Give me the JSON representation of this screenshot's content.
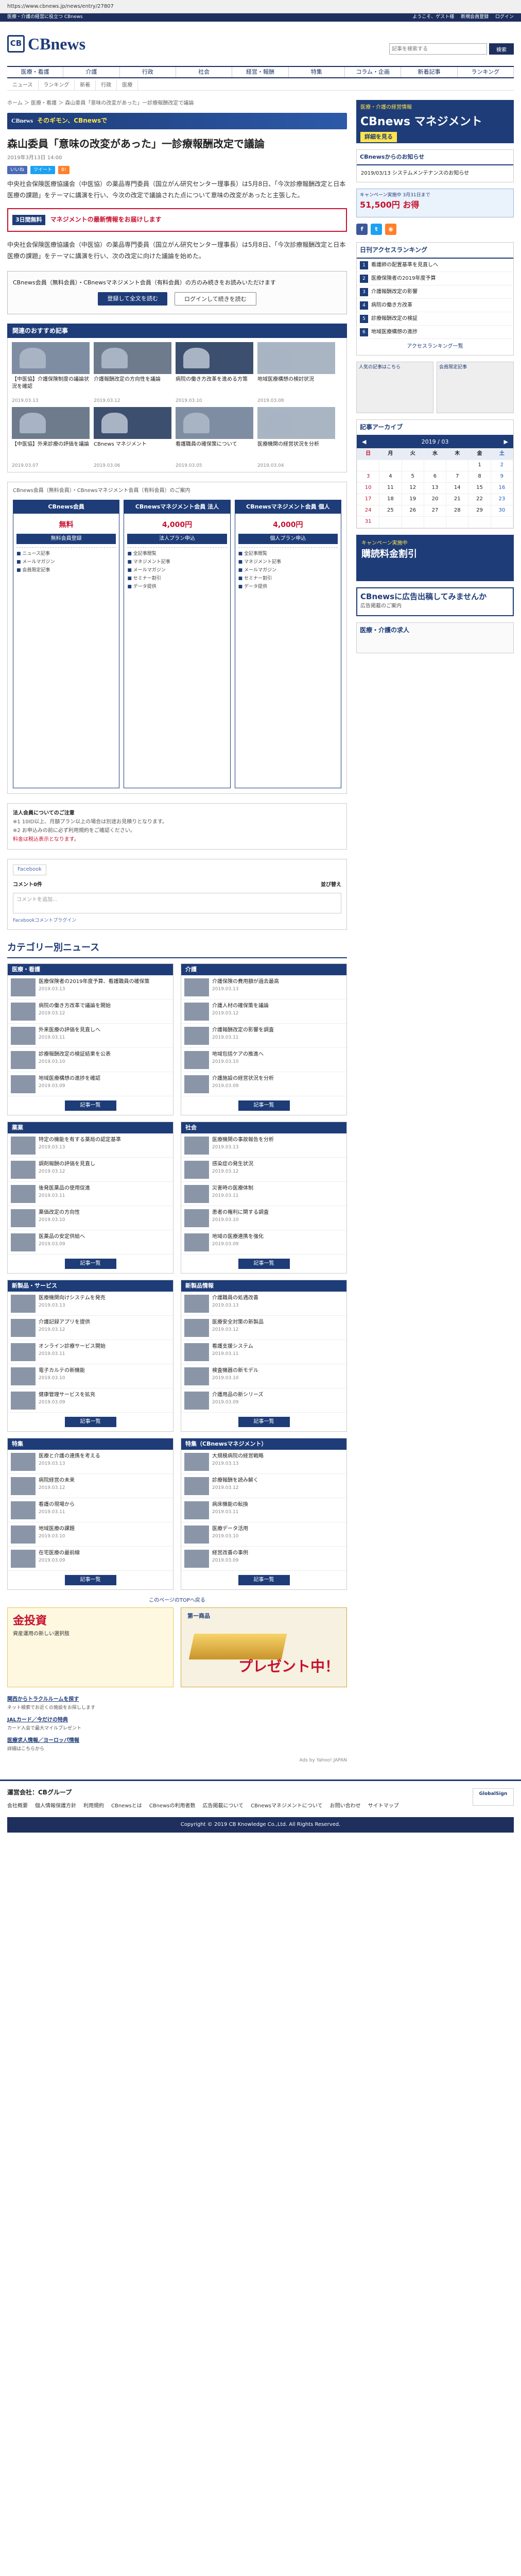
{
  "browser": {
    "url": "https://www.cbnews.jp/news/entry/27807"
  },
  "top": {
    "left": "医療・介護の経営に役立つ CBnews",
    "links": [
      "ようこそ、ゲスト様",
      "新規会員登録",
      "ログイン"
    ]
  },
  "brand": {
    "mark": "CB",
    "name": "CBnews"
  },
  "search": {
    "placeholder": "記事を検索する",
    "button": "検索"
  },
  "nav": [
    "医療・看護",
    "介護",
    "行政",
    "社会",
    "経営・報酬",
    "特集",
    "コラム・企画",
    "新着記事",
    "ランキング"
  ],
  "subnav": [
    "ニュース",
    "ランキング",
    "新着",
    "行政",
    "医療"
  ],
  "breadcrumb": "ホーム ＞ 医療・看護 ＞ 森山委員「意味の改変があった」一診療報酬改定で議論",
  "banner": {
    "logo": "CBnews",
    "text": "そのギモン、CBnewsで"
  },
  "article": {
    "title": "森山委員「意味の改変があった」一診療報酬改定で議論",
    "date": "2019年3月13日 14:00",
    "share": [
      "いいね",
      "ツイート",
      "B!"
    ],
    "p1": "中央社会保険医療協議会（中医協）の薬品専門委員（国立がん研究センター理事長）は5月8日、「今次診療報酬改定と日本医療の課題」をテーマに講演を行い、今次の改定で議論された点について意味の改変があったと主張した。",
    "p2": "中央社会保険医療協議会（中医協）の薬品専門委員（国立がん研究センター理事長）は5月8日、「今次診療報酬改定と日本医療の課題」をテーマに講演を行い、次の改定に向けた議論を始めた。",
    "lock_text": "CBnews会員（無料会員）・CBnewsマネジメント会員（有料会員）の方のみ続きをお読みいただけます",
    "lock_login": "登録して全文を読む",
    "lock_member": "ログインして続きを読む"
  },
  "promo": {
    "label": "3日間無料",
    "text": "マネジメントの最新情報をお届けします"
  },
  "related": {
    "title": "関連のおすすめ記事",
    "items": [
      {
        "title": "【中医協】介護保険制度の議論状況を確認",
        "date": "2019.03.13"
      },
      {
        "title": "介護報酬改定の方向性を議論",
        "date": "2019.03.12"
      },
      {
        "title": "病院の働き方改革を進める方策",
        "date": "2019.03.10"
      },
      {
        "title": "地域医療構想の検討状況",
        "date": "2019.03.08"
      },
      {
        "title": "【中医協】外来診療の評価を議論",
        "date": "2019.03.07"
      },
      {
        "title": "CBnews マネジメント",
        "date": "2019.03.06"
      },
      {
        "title": "看護職員の確保策について",
        "date": "2019.03.05"
      },
      {
        "title": "医療機関の経営状況を分析",
        "date": "2019.03.04"
      }
    ]
  },
  "plans": {
    "intro": "CBnews会員（無料会員）・CBnewsマネジメント会員（有料会員）のご案内",
    "cols": [
      {
        "name": "CBnews会員",
        "price": "無料",
        "btn": "無料会員登録",
        "feats": [
          "ニュース記事",
          "メールマガジン",
          "会員限定記事"
        ]
      },
      {
        "name": "CBnewsマネジメント会員 法人",
        "price": "4,000円",
        "btn": "法人プラン申込",
        "feats": [
          "全記事閲覧",
          "マネジメント記事",
          "メールマガジン",
          "セミナー割引",
          "データ提供"
        ]
      },
      {
        "name": "CBnewsマネジメント会員 個人",
        "price": "4,000円",
        "btn": "個人プラン申込",
        "feats": [
          "全記事閲覧",
          "マネジメント記事",
          "メールマガジン",
          "セミナー割引",
          "データ提供"
        ]
      }
    ]
  },
  "notes": {
    "title": "法人会員についてのご注意",
    "l1": "※1 10ID以上、月額プラン以上の場合は別途お見積りとなります。",
    "l2": "※2 お申込みの前に必ず利用規約をご確認ください。",
    "red": "料金は税込表示となります。"
  },
  "fb": {
    "tab": "Facebook",
    "count": "コメント0件",
    "sort": "並び替え",
    "placeholder": "コメントを追加...",
    "plugin": "Facebookコメントプラグイン"
  },
  "category": {
    "title": "カテゴリー別ニュース",
    "more": "記事一覧",
    "boxes": [
      {
        "name": "医療・看護",
        "items": [
          {
            "t": "医療保険者の2019年度予算、看護職員の確保策",
            "d": "2019.03.13"
          },
          {
            "t": "病院の働き方改革で議論を開始",
            "d": "2019.03.12"
          },
          {
            "t": "外来医療の評価を見直しへ",
            "d": "2019.03.11"
          },
          {
            "t": "診療報酬改定の検証結果を公表",
            "d": "2019.03.10"
          },
          {
            "t": "地域医療構想の進捗を確認",
            "d": "2019.03.09"
          }
        ]
      },
      {
        "name": "介護",
        "items": [
          {
            "t": "介護保険の費用額が過去最高",
            "d": "2019.03.13"
          },
          {
            "t": "介護人材の確保策を議論",
            "d": "2019.03.12"
          },
          {
            "t": "介護報酬改定の影響を調査",
            "d": "2019.03.11"
          },
          {
            "t": "地域包括ケアの推進へ",
            "d": "2019.03.10"
          },
          {
            "t": "介護施設の経営状況を分析",
            "d": "2019.03.09"
          }
        ]
      },
      {
        "name": "薬業",
        "items": [
          {
            "t": "特定の機能を有する薬局の認定基準",
            "d": "2019.03.13"
          },
          {
            "t": "調剤報酬の評価を見直し",
            "d": "2019.03.12"
          },
          {
            "t": "後発医薬品の使用促進",
            "d": "2019.03.11"
          },
          {
            "t": "薬価改定の方向性",
            "d": "2019.03.10"
          },
          {
            "t": "医薬品の安定供給へ",
            "d": "2019.03.09"
          }
        ]
      },
      {
        "name": "社会",
        "items": [
          {
            "t": "医療機関の事故報告を分析",
            "d": "2019.03.13"
          },
          {
            "t": "感染症の発生状況",
            "d": "2019.03.12"
          },
          {
            "t": "災害時の医療体制",
            "d": "2019.03.11"
          },
          {
            "t": "患者の権利に関する調査",
            "d": "2019.03.10"
          },
          {
            "t": "地域の医療連携を強化",
            "d": "2019.03.09"
          }
        ]
      },
      {
        "name": "新製品・サービス",
        "items": [
          {
            "t": "医療機関向けシステムを発売",
            "d": "2019.03.13"
          },
          {
            "t": "介護記録アプリを提供",
            "d": "2019.03.12"
          },
          {
            "t": "オンライン診療サービス開始",
            "d": "2019.03.11"
          },
          {
            "t": "電子カルテの新機能",
            "d": "2019.03.10"
          },
          {
            "t": "健康管理サービスを拡充",
            "d": "2019.03.09"
          }
        ]
      },
      {
        "name": "新製品情報",
        "items": [
          {
            "t": "介護職員の処遇改善",
            "d": "2019.03.13"
          },
          {
            "t": "医療安全対策の新製品",
            "d": "2019.03.12"
          },
          {
            "t": "看護支援システム",
            "d": "2019.03.11"
          },
          {
            "t": "検査機器の新モデル",
            "d": "2019.03.10"
          },
          {
            "t": "介護用品の新シリーズ",
            "d": "2019.03.09"
          }
        ]
      },
      {
        "name": "特集",
        "items": [
          {
            "t": "医療と介護の連携を考える",
            "d": "2019.03.13"
          },
          {
            "t": "病院経営の未来",
            "d": "2019.03.12"
          },
          {
            "t": "看護の現場から",
            "d": "2019.03.11"
          },
          {
            "t": "地域医療の課題",
            "d": "2019.03.10"
          },
          {
            "t": "在宅医療の最前線",
            "d": "2019.03.09"
          }
        ]
      },
      {
        "name": "特集（CBnewsマネジメント）",
        "items": [
          {
            "t": "大規模病院の経営戦略",
            "d": "2019.03.13"
          },
          {
            "t": "診療報酬を読み解く",
            "d": "2019.03.12"
          },
          {
            "t": "病床機能の転換",
            "d": "2019.03.11"
          },
          {
            "t": "医療データ活用",
            "d": "2019.03.10"
          },
          {
            "t": "経営改善の事例",
            "d": "2019.03.09"
          }
        ]
      }
    ]
  },
  "nextlink": "このページのTOPへ戻る",
  "ads": {
    "a1": "金投資",
    "a1s": "資産運用の新しい選択肢",
    "a2": "第一商品",
    "a2b": "プレゼント中！",
    "text": [
      {
        "t": "関西からトラクルルームを探す",
        "s": "ネット検索でお近くの施設をお探しします"
      },
      {
        "t": "JALカード／今だけの特典",
        "s": "カード入会で最大マイルプレゼント"
      },
      {
        "t": "医療求人情報／ヨーロッパ情報",
        "s": "詳細はこちらから"
      }
    ],
    "by": "Ads by Yahoo! JAPAN"
  },
  "side": {
    "banner_top": "医療・介護の経営情報",
    "banner_name": "CBnews マネジメント",
    "banner_btn": "詳細を見る",
    "info_title": "CBnewsからのお知らせ",
    "info_text": "2019/03/13 システムメンテナンスのお知らせ",
    "camp_1": "キャンペーン実施中 3月31日まで",
    "camp_2": "51,500円 お得",
    "rank_title": "日刊アクセスランキング",
    "rank": [
      "看護師の配置基準を見直しへ",
      "医療保険者の2019年度予算",
      "介護報酬改定の影響",
      "病院の働き方改革",
      "診療報酬改定の検証",
      "地域医療構想の進捗"
    ],
    "rank_more": "アクセスランキング一覧",
    "sidead1": "人気の記事はこちら",
    "sidead2": "会員限定記事",
    "cal_title": "記事アーカイブ",
    "cal_month": "2019 / 03",
    "dow": [
      "日",
      "月",
      "火",
      "水",
      "木",
      "金",
      "土"
    ],
    "weeks": [
      [
        "",
        "",
        "",
        "",
        "",
        "1",
        "2"
      ],
      [
        "3",
        "4",
        "5",
        "6",
        "7",
        "8",
        "9"
      ],
      [
        "10",
        "11",
        "12",
        "13",
        "14",
        "15",
        "16"
      ],
      [
        "17",
        "18",
        "19",
        "20",
        "21",
        "22",
        "23"
      ],
      [
        "24",
        "25",
        "26",
        "27",
        "28",
        "29",
        "30"
      ],
      [
        "31",
        "",
        "",
        "",
        "",
        "",
        ""
      ]
    ],
    "b2_1": "キャンペーン実施中",
    "b2_2": "購読料金割引",
    "b3_1": "CBnewsに広告出稿してみませんか",
    "b3_2": "広告掲載のご案内",
    "b4": "医療・介護の求人"
  },
  "footer": {
    "company": "運営会社：CBグループ",
    "links": [
      "会社概要",
      "個人情報保護方針",
      "利用規約",
      "CBnewsとは",
      "CBnewsの利用者数",
      "広告掲載について",
      "CBnewsマネジメントについて",
      "お問い合わせ",
      "サイトマップ"
    ],
    "copyright": "Copyright © 2019 CB Knowledge Co.,Ltd. All Rights Reserved.",
    "gs": "GlobalSign"
  }
}
